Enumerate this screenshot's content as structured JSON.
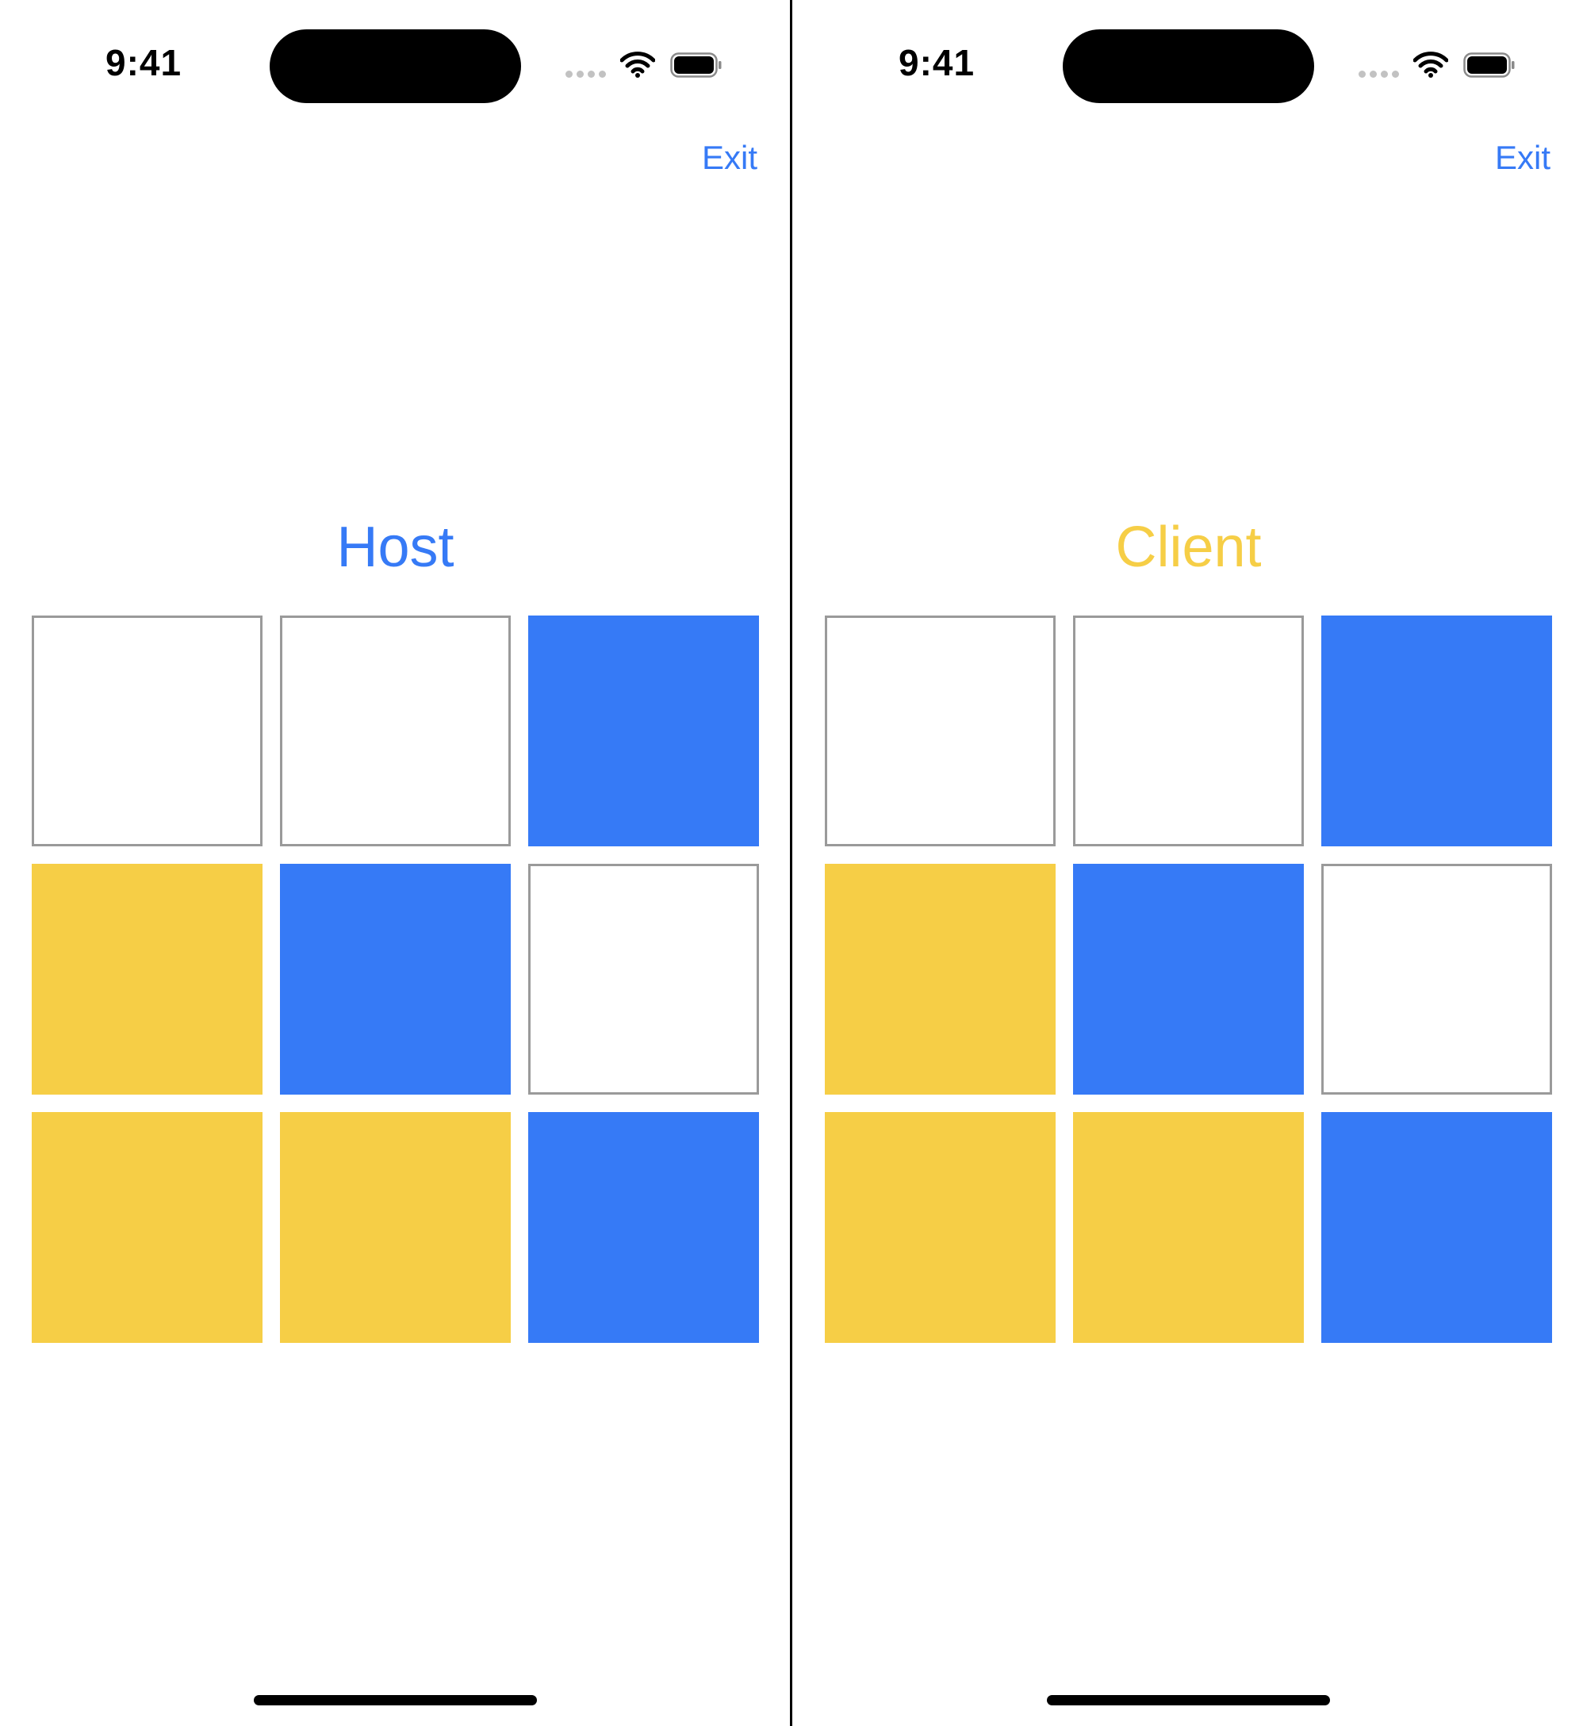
{
  "colors": {
    "host": "#367af6",
    "client": "#f6ce46",
    "empty": "#ffffff",
    "link": "#367af6"
  },
  "screens": [
    {
      "status": {
        "time": "9:41"
      },
      "nav": {
        "exit_label": "Exit"
      },
      "player": {
        "label": "Host",
        "color": "#367af6"
      },
      "board": [
        "empty",
        "empty",
        "host",
        "client",
        "host",
        "empty",
        "client",
        "client",
        "host"
      ]
    },
    {
      "status": {
        "time": "9:41"
      },
      "nav": {
        "exit_label": "Exit"
      },
      "player": {
        "label": "Client",
        "color": "#f6ce46"
      },
      "board": [
        "empty",
        "empty",
        "host",
        "client",
        "host",
        "empty",
        "client",
        "client",
        "host"
      ]
    }
  ]
}
